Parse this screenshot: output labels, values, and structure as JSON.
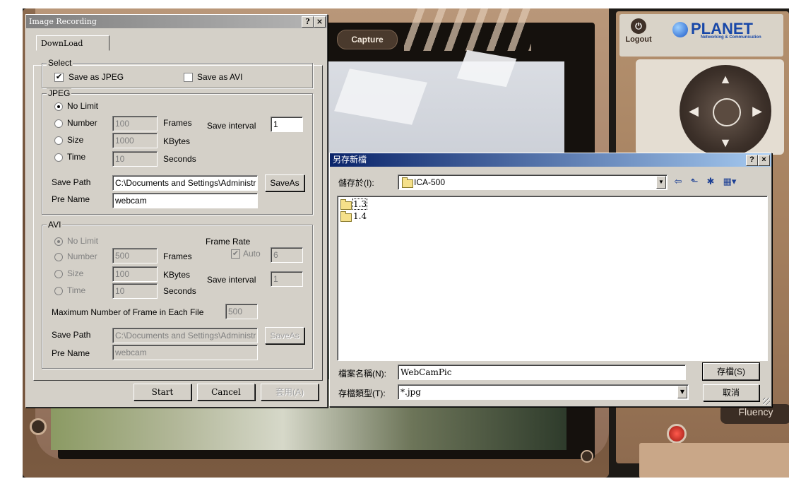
{
  "background_app": {
    "capture_label": "Capture",
    "logout_label": "Logout",
    "brand": "PLANET",
    "brand_tagline": "Networking & Communication",
    "fluency_label": "Fluency"
  },
  "recording_dialog": {
    "title": "Image Recording",
    "help_btn": "?",
    "close_btn": "×",
    "tab_label": "DownLoad",
    "select_group": {
      "legend": "Select",
      "save_jpeg_label": "Save as JPEG",
      "save_jpeg_checked": true,
      "save_avi_label": "Save as AVI",
      "save_avi_checked": false
    },
    "jpeg_group": {
      "legend": "JPEG",
      "no_limit_label": "No Limit",
      "number_label": "Number",
      "number_value": "100",
      "frames_unit": "Frames",
      "size_label": "Size",
      "size_value": "1000",
      "kbytes_unit": "KBytes",
      "time_label": "Time",
      "time_value": "10",
      "seconds_unit": "Seconds",
      "save_interval_label": "Save interval",
      "save_interval_value": "1",
      "save_path_label": "Save Path",
      "save_path_value": "C:\\Documents and Settings\\Administr",
      "saveas_label": "SaveAs",
      "pre_name_label": "Pre Name",
      "pre_name_value": "webcam",
      "selected_option": "No Limit"
    },
    "avi_group": {
      "legend": "AVI",
      "no_limit_label": "No Limit",
      "number_label": "Number",
      "number_value": "500",
      "frames_unit": "Frames",
      "size_label": "Size",
      "size_value": "100",
      "kbytes_unit": "KBytes",
      "time_label": "Time",
      "time_value": "10",
      "seconds_unit": "Seconds",
      "frame_rate_label": "Frame Rate",
      "auto_label": "Auto",
      "auto_checked": true,
      "frame_rate_value": "6",
      "save_interval_label": "Save interval",
      "save_interval_value": "1",
      "max_frames_label": "Maximum Number of Frame in Each File",
      "max_frames_value": "500",
      "save_path_label": "Save Path",
      "save_path_value": "C:\\Documents and Settings\\Administr",
      "saveas_label": "SaveAs",
      "pre_name_label": "Pre Name",
      "pre_name_value": "webcam"
    },
    "buttons": {
      "start": "Start",
      "cancel": "Cancel",
      "apply": "套用(A)"
    }
  },
  "save_dialog": {
    "title": "另存新檔",
    "help_btn": "?",
    "close_btn": "×",
    "save_in_label": "儲存於(I):",
    "save_in_value": "ICA-500",
    "toolbar_icons": [
      "back-icon",
      "up-folder-icon",
      "new-folder-icon",
      "view-menu-icon"
    ],
    "files": [
      {
        "name": "1.3",
        "icon": "folder-icon",
        "focused": true
      },
      {
        "name": "1.4",
        "icon": "folder-icon",
        "focused": false
      }
    ],
    "filename_label": "檔案名稱(N):",
    "filename_value": "WebCamPic",
    "filetype_label": "存檔類型(T):",
    "filetype_value": "*.jpg",
    "save_btn": "存檔(S)",
    "cancel_btn": "取消"
  }
}
